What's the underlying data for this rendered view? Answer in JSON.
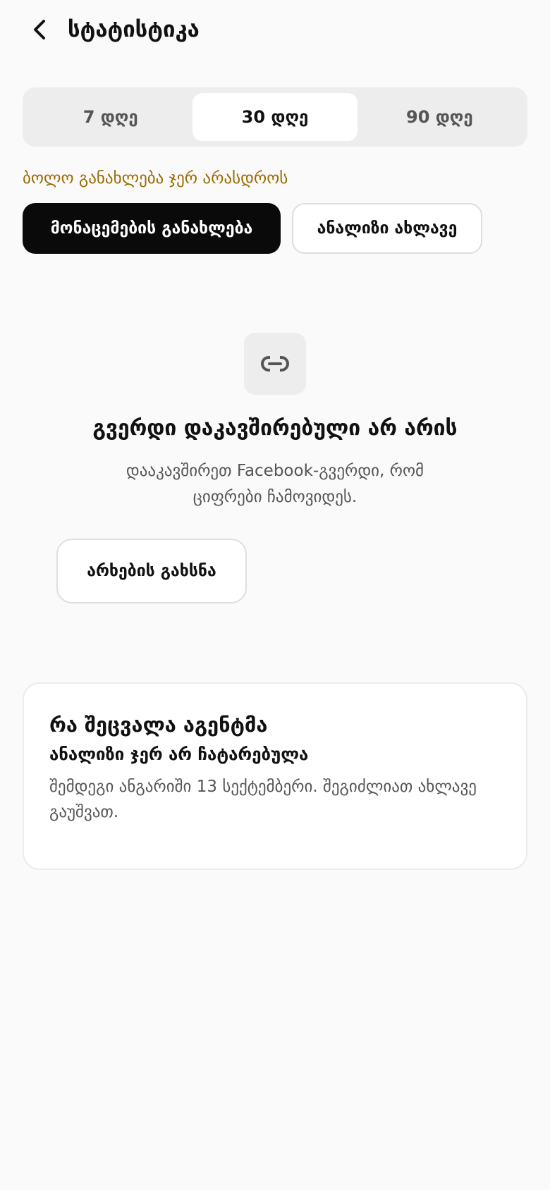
{
  "header": {
    "title": "სტატისტიკა",
    "back_icon": "chevron-left-icon"
  },
  "periods": {
    "items": [
      {
        "label": "7 დღე",
        "active": false
      },
      {
        "label": "30 დღე",
        "active": true
      },
      {
        "label": "90 დღე",
        "active": false
      }
    ]
  },
  "status": {
    "last_update": "ბოლო განახლება ჯერ არასდროს"
  },
  "actions": {
    "refresh_label": "მონაცემების განახლება",
    "analyze_label": "ანალიზი ახლავე"
  },
  "empty_state": {
    "icon": "link-icon",
    "title": "გვერდი დაკავშირებული არ არის",
    "description": "დააკავშირეთ Facebook-გვერდი, რომ ციფრები ჩამოვიდეს.",
    "button_label": "არხების გახსნა"
  },
  "agent_card": {
    "title": "რა შეცვალა აგენტმა",
    "subtitle": "ანალიზი ჯერ არ ჩატარებულა",
    "description": "შემდეგი ანგარიში 13 სექტემბერი. შეგიძლიათ ახლავე გაუშვათ."
  },
  "colors": {
    "accent_status": "#9a6a00",
    "primary_button": "#0a0a0a",
    "background": "#fafafa"
  }
}
